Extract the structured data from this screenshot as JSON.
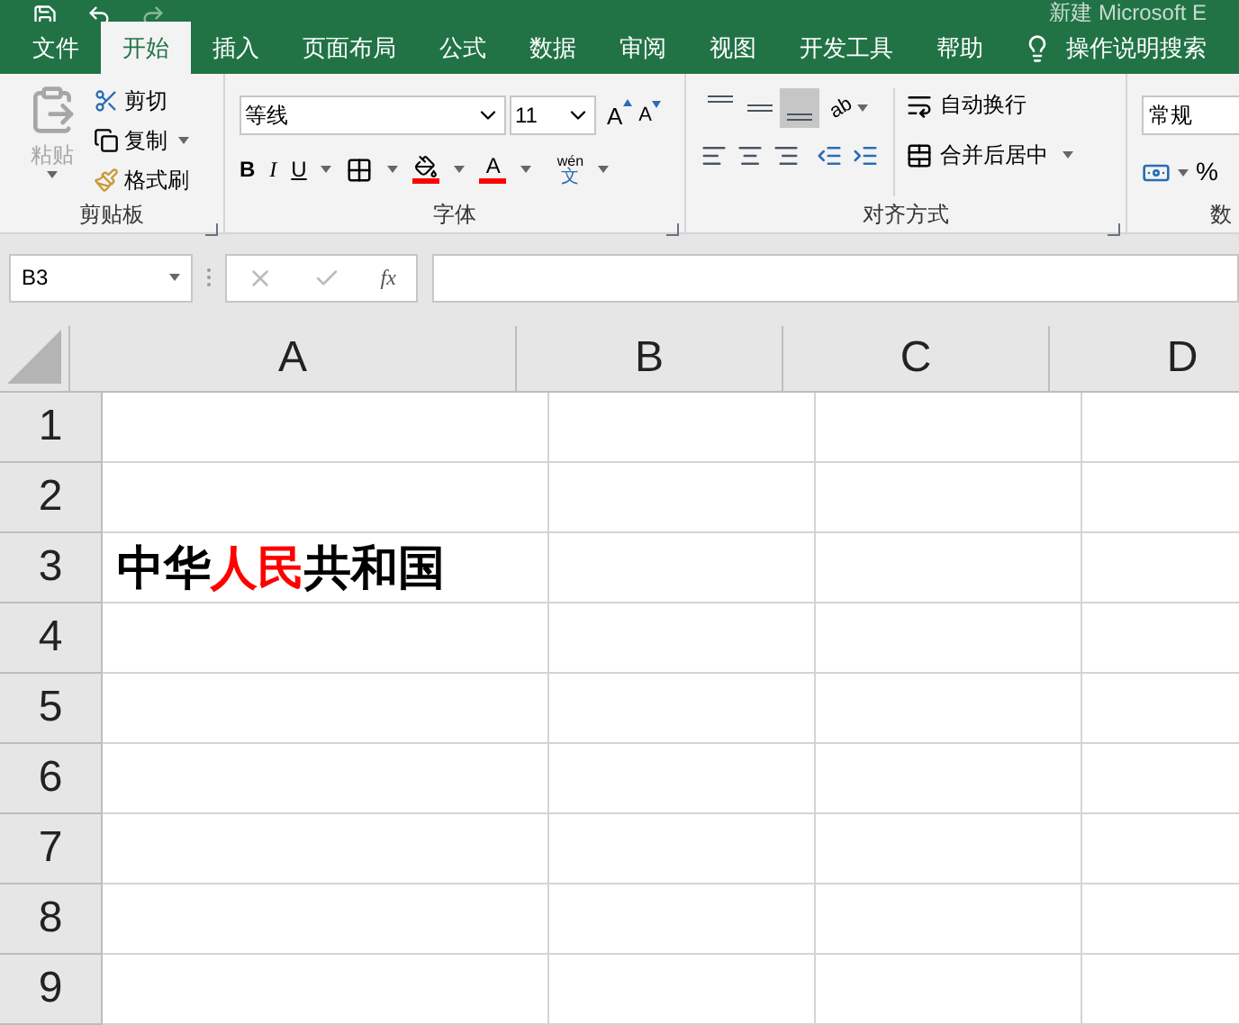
{
  "window": {
    "title": "新建 Microsoft E"
  },
  "tabs": [
    {
      "label": "文件",
      "selected": false
    },
    {
      "label": "开始",
      "selected": true
    },
    {
      "label": "插入",
      "selected": false
    },
    {
      "label": "页面布局",
      "selected": false
    },
    {
      "label": "公式",
      "selected": false
    },
    {
      "label": "数据",
      "selected": false
    },
    {
      "label": "审阅",
      "selected": false
    },
    {
      "label": "视图",
      "selected": false
    },
    {
      "label": "开发工具",
      "selected": false
    },
    {
      "label": "帮助",
      "selected": false
    }
  ],
  "tell_me": "操作说明搜索",
  "clipboard": {
    "label": "剪贴板",
    "paste": {
      "label": "粘贴",
      "disabled": true
    },
    "cut": "剪切",
    "copy": "复制",
    "format_painter": "格式刷"
  },
  "font": {
    "label": "字体",
    "name": "等线",
    "size": "11",
    "phonetic": "wén",
    "phonetic_char": "文",
    "grow": "A",
    "shrink": "A",
    "bold": "B",
    "italic": "I",
    "underline": "U",
    "color_letter": "A"
  },
  "alignment": {
    "label": "对齐方式",
    "vertical": [
      {
        "kind": "top",
        "selected": false
      },
      {
        "kind": "middle",
        "selected": false
      },
      {
        "kind": "bottom",
        "selected": true
      }
    ],
    "orientation": "ab",
    "wrap": "自动换行",
    "merge": "合并后居中"
  },
  "number": {
    "format": "常规",
    "percent": "%",
    "label": "数"
  },
  "formula_bar": {
    "name_box": "B3",
    "fx": "fx"
  },
  "columns": [
    "A",
    "B",
    "C",
    "D"
  ],
  "rows": [
    {
      "header": "1",
      "cells": []
    },
    {
      "header": "2",
      "cells": []
    },
    {
      "header": "3",
      "cells": [
        {
          "runs": [
            {
              "text": "中华",
              "color": "#000000"
            },
            {
              "text": "人民",
              "color": "#ff0000"
            },
            {
              "text": "共和国",
              "color": "#000000"
            }
          ]
        }
      ]
    },
    {
      "header": "4",
      "cells": []
    },
    {
      "header": "5",
      "cells": []
    },
    {
      "header": "6",
      "cells": []
    },
    {
      "header": "7",
      "cells": []
    },
    {
      "header": "8",
      "cells": []
    },
    {
      "header": "9",
      "cells": []
    }
  ]
}
